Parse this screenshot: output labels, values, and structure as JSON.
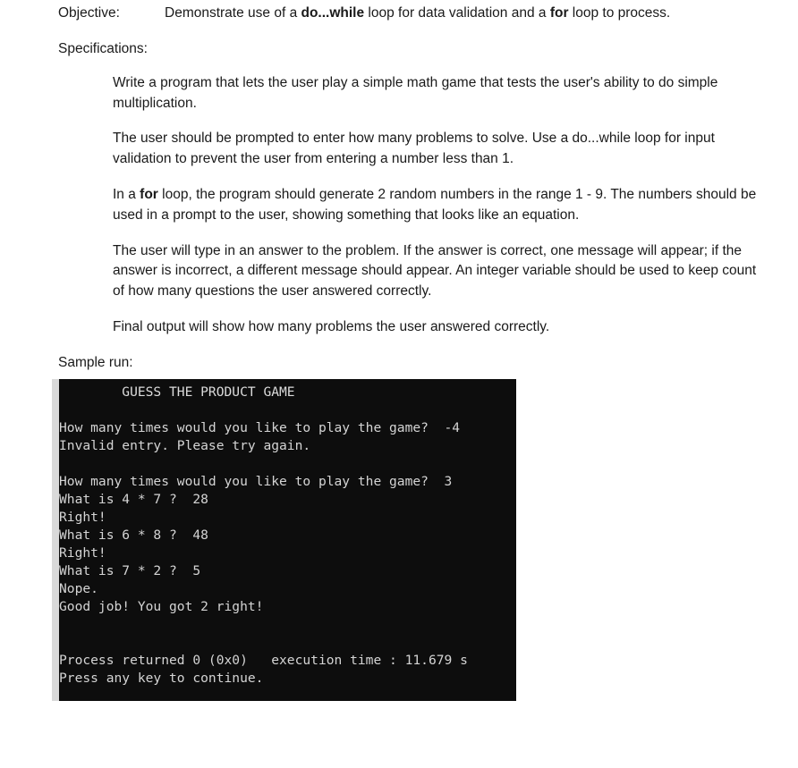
{
  "document": {
    "objective": {
      "label": "Objective:",
      "text_before_bold1": "Demonstrate use of a ",
      "bold1": "do...while",
      "text_mid": " loop for data validation and a ",
      "bold2": "for",
      "text_after": " loop to process."
    },
    "specifications_heading": "Specifications:",
    "specifications": [
      {
        "id": "spec-1",
        "text": "Write a program that lets the user play a simple math game that tests the user's ability to do simple multiplication."
      },
      {
        "id": "spec-2",
        "text": "The user should be prompted to enter how many problems to solve. Use a do...while loop for input validation to prevent the user from entering a number less than 1."
      },
      {
        "id": "spec-3",
        "text_before_bold": "In a ",
        "bold": "for",
        "text_after_bold": " loop, the program should generate 2 random numbers in the range 1 - 9. The numbers should be used in a prompt to the user, showing something that looks like an equation."
      },
      {
        "id": "spec-4",
        "text": "The user will type in an answer to the problem. If the answer is correct, one message will appear; if the answer is incorrect, a different message should appear. An integer variable should be used to keep count of how many questions the user answered correctly."
      },
      {
        "id": "spec-5",
        "text": "Final output will show how many problems the user answered correctly."
      }
    ],
    "sample_run_label": "Sample run:"
  },
  "console": {
    "background_color": "#0d0d0d",
    "text_color": "#d4d4d4",
    "lines": [
      "        GUESS THE PRODUCT GAME",
      "",
      "How many times would you like to play the game?  -4",
      "Invalid entry. Please try again.",
      "",
      "How many times would you like to play the game?  3",
      "What is 4 * 7 ?  28",
      "Right!",
      "What is 6 * 8 ?  48",
      "Right!",
      "What is 7 * 2 ?  5",
      "Nope.",
      "Good job! You got 2 right!",
      "",
      "",
      "Process returned 0 (0x0)   execution time : 11.679 s",
      "Press any key to continue."
    ]
  }
}
